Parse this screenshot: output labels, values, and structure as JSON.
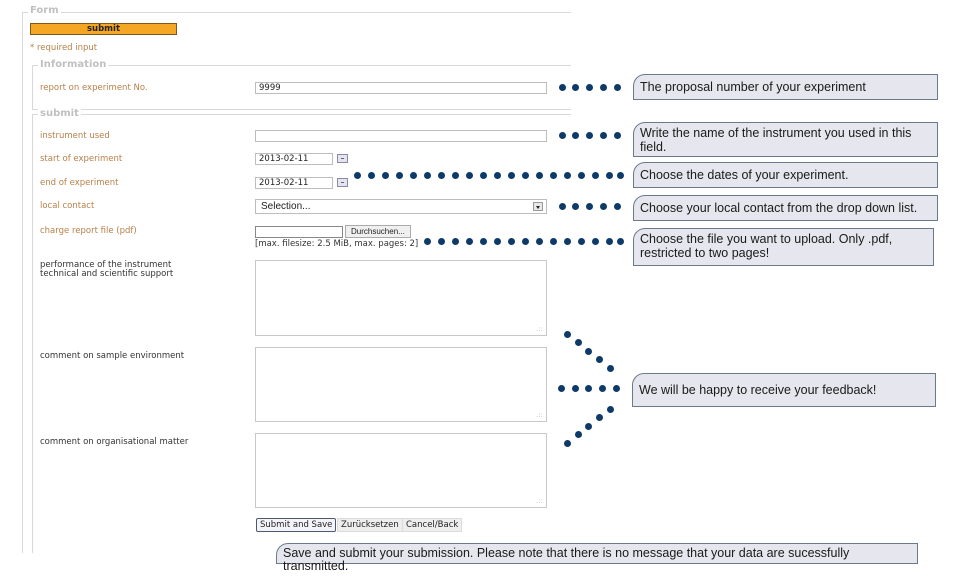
{
  "form": {
    "legend": "Form",
    "top_submit_label": "submit",
    "required_note": "* required input",
    "accent_color": "#f5a623"
  },
  "information": {
    "legend": "Information",
    "experiment_no_label": "report on experiment No.",
    "experiment_no_value": "9999"
  },
  "submit_section": {
    "legend": "submit",
    "instrument_label": "instrument used",
    "instrument_value": "",
    "start_label": "start of experiment",
    "start_value": "2013-02-11",
    "end_label": "end of experiment",
    "end_value": "2013-02-11",
    "contact_label": "local contact",
    "contact_value": "Selection...",
    "file_label": "charge report file (pdf)",
    "file_value": "",
    "browse_label": "Durchsuchen...",
    "file_hint": "[max. filesize: 2.5 MiB, max. pages: 2]",
    "performance_label_line1": "performance of the instrument",
    "performance_label_line2": "technical and scientific support",
    "sample_env_label": "comment on sample environment",
    "org_matter_label": "comment on organisational matter"
  },
  "buttons": {
    "submit_save": "Submit and Save",
    "reset": "Zurücksetzen",
    "cancel": "Cancel/Back"
  },
  "callouts": {
    "proposal": "The proposal number of your experiment",
    "instrument": "Write the name of the instrument you used in this field.",
    "dates": "Choose the dates of your experiment.",
    "contact": "Choose your local contact from the drop down list.",
    "file": "Choose the file you want to upload. Only .pdf, restricted to two pages!",
    "feedback": "We will be happy to receive your feedback!",
    "save": "Save and submit your submission. Please note that there is no message that your data are sucessfully transmitted."
  },
  "icons": {
    "calendar": "calendar-icon",
    "dropdown": "chevron-down-icon",
    "connector": "dotted-connector"
  }
}
